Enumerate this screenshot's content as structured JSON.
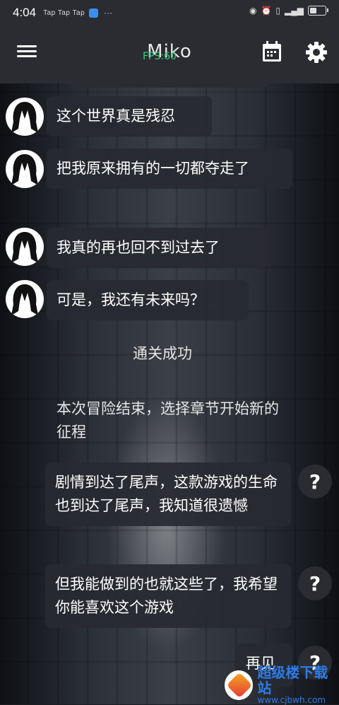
{
  "status_bar": {
    "time": "4:04",
    "apps": "Tap Tap Tap",
    "more": "···",
    "battery_level": 0.4
  },
  "header": {
    "title": "Miko",
    "fps_label": "FPS:60",
    "calendar_icon": "calendar-icon",
    "settings_icon": "gear-icon",
    "menu_icon": "hamburger-menu-icon"
  },
  "chat": {
    "npc_messages": [
      "这个世界真是残忍",
      "把我原来拥有的一切都夺走了",
      "我真的再也回不到过去了",
      "可是，我还有未来吗？"
    ],
    "system_messages": [
      "通关成功",
      "本次冒险结束，选择章节开始新的征程"
    ],
    "player_messages": [
      "剧情到达了尾声，这款游戏的生命也到达了尾声，我知道很遗憾",
      "但我能做到的也就这些了，我希望你能喜欢这个游戏",
      "再见"
    ],
    "help_label": "?"
  },
  "watermark": {
    "site_name": "超级楼下载站",
    "site_url": "www.cjbwh.com"
  },
  "colors": {
    "bar_bg": "#2a2c31",
    "bubble_bg": "#282a30",
    "fps_green": "#35d27a"
  }
}
